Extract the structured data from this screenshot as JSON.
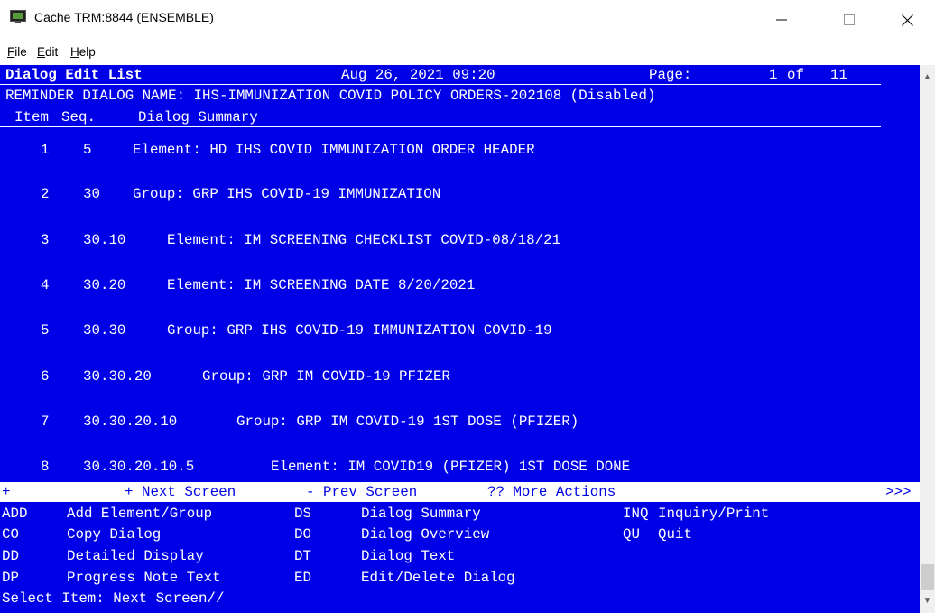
{
  "window": {
    "title": "Cache TRM:8844 (ENSEMBLE)"
  },
  "menu": [
    {
      "accel": "F",
      "rest": "ile"
    },
    {
      "accel": "E",
      "rest": "dit"
    },
    {
      "accel": "H",
      "rest": "elp"
    }
  ],
  "header": {
    "title": "Dialog Edit List",
    "datetime": "Aug 26, 2021 09:20",
    "page_label": "Page:",
    "page_num": "1",
    "page_of": "of",
    "page_total": "11",
    "dialog_name": "REMINDER DIALOG NAME: IHS-IMMUNIZATION COVID POLICY ORDERS-202108 (Disabled)",
    "col_item": "Item",
    "col_seq": "Seq.",
    "col_summary": "Dialog Summary"
  },
  "items": [
    {
      "num": "1",
      "seq": "5",
      "text": "Element: HD IHS COVID IMMUNIZATION ORDER HEADER"
    },
    {
      "num": "2",
      "seq": "30",
      "text": "Group: GRP IHS COVID-19 IMMUNIZATION"
    },
    {
      "num": "3",
      "seq": "30.10",
      "text": "Element: IM SCREENING CHECKLIST COVID-08/18/21"
    },
    {
      "num": "4",
      "seq": "30.20",
      "text": "Element: IM SCREENING DATE 8/20/2021"
    },
    {
      "num": "5",
      "seq": "30.30",
      "text": "Group: GRP IHS COVID-19 IMMUNIZATION COVID-19"
    },
    {
      "num": "6",
      "seq": "30.30.20",
      "text": "Group: GRP IM COVID-19 PFIZER"
    },
    {
      "num": "7",
      "seq": "30.30.20.10",
      "text": "Group: GRP IM COVID-19 1ST DOSE (PFIZER)"
    },
    {
      "num": "8",
      "seq": "30.30.20.10.5",
      "text": "Element: IM COVID19 (PFIZER) 1ST DOSE DONE"
    }
  ],
  "nav": {
    "plus": "+",
    "next": "+ Next Screen",
    "prev": "- Prev Screen",
    "more": "?? More Actions",
    "arrows": ">>>"
  },
  "actions": [
    {
      "code": "ADD",
      "label": "Add Element/Group"
    },
    {
      "code": "DS",
      "label": "Dialog Summary"
    },
    {
      "code": "INQ",
      "label": "Inquiry/Print"
    },
    {
      "code": "CO",
      "label": "Copy Dialog"
    },
    {
      "code": "DO",
      "label": "Dialog Overview"
    },
    {
      "code": "QU",
      "label": "Quit"
    },
    {
      "code": "DD",
      "label": "Detailed Display"
    },
    {
      "code": "DT",
      "label": "Dialog Text"
    },
    {
      "code": "DP",
      "label": "Progress Note Text"
    },
    {
      "code": "ED",
      "label": "Edit/Delete Dialog"
    }
  ],
  "prompt": "Select Item: Next Screen//",
  "colors": {
    "terminal_bg": "#0000E6",
    "terminal_fg": "#FFFFFF"
  },
  "icons": {
    "app": "terminal-icon",
    "minimize": "minimize-icon",
    "maximize": "maximize-icon",
    "close": "close-icon"
  }
}
